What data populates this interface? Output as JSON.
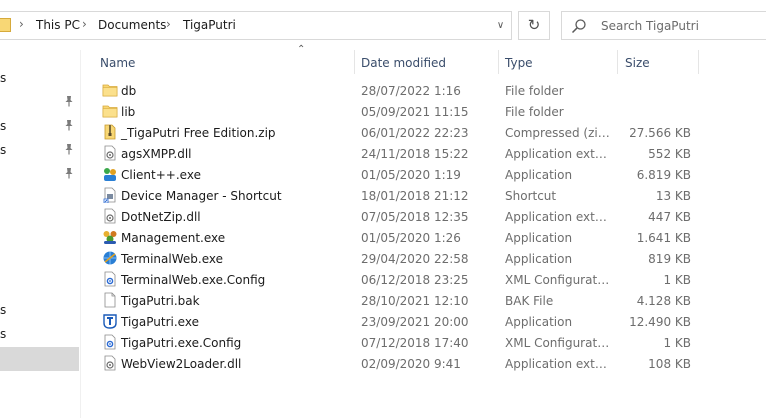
{
  "breadcrumb": {
    "items": [
      "This PC",
      "Documents",
      "TigaPutri"
    ],
    "separator": ">"
  },
  "search": {
    "placeholder": "Search TigaPutri"
  },
  "nav": {
    "fragments": [
      "s",
      "s",
      "s",
      "s",
      "s"
    ]
  },
  "columns": {
    "name": "Name",
    "date": "Date modified",
    "type": "Type",
    "size": "Size"
  },
  "files": [
    {
      "name": "db",
      "date": "28/07/2022 1:16",
      "type": "File folder",
      "size": "",
      "icon": "folder-icon"
    },
    {
      "name": "lib",
      "date": "05/09/2021 11:15",
      "type": "File folder",
      "size": "",
      "icon": "folder-icon"
    },
    {
      "name": "_TigaPutri Free Edition.zip",
      "date": "06/01/2022 22:23",
      "type": "Compressed (zipp...",
      "size": "27.566 KB",
      "icon": "zip-file-icon"
    },
    {
      "name": "agsXMPP.dll",
      "date": "24/11/2018 15:22",
      "type": "Application exten...",
      "size": "552 KB",
      "icon": "dll-file-icon"
    },
    {
      "name": "Client++.exe",
      "date": "01/05/2020 1:19",
      "type": "Application",
      "size": "6.819 KB",
      "icon": "client-app-icon"
    },
    {
      "name": "Device Manager - Shortcut",
      "date": "18/01/2018 21:12",
      "type": "Shortcut",
      "size": "13 KB",
      "icon": "device-manager-icon"
    },
    {
      "name": "DotNetZip.dll",
      "date": "07/05/2018 12:35",
      "type": "Application exten...",
      "size": "447 KB",
      "icon": "dll-file-icon"
    },
    {
      "name": "Management.exe",
      "date": "01/05/2020 1:26",
      "type": "Application",
      "size": "1.641 KB",
      "icon": "management-app-icon"
    },
    {
      "name": "TerminalWeb.exe",
      "date": "29/04/2020 22:58",
      "type": "Application",
      "size": "819 KB",
      "icon": "terminal-web-app-icon"
    },
    {
      "name": "TerminalWeb.exe.Config",
      "date": "06/12/2018 23:25",
      "type": "XML Configuratio...",
      "size": "1 KB",
      "icon": "config-file-icon"
    },
    {
      "name": "TigaPutri.bak",
      "date": "28/10/2021 12:10",
      "type": "BAK File",
      "size": "4.128 KB",
      "icon": "blank-file-icon"
    },
    {
      "name": "TigaPutri.exe",
      "date": "23/09/2021 20:00",
      "type": "Application",
      "size": "12.490 KB",
      "icon": "tigaputri-app-icon"
    },
    {
      "name": "TigaPutri.exe.Config",
      "date": "07/12/2018 17:40",
      "type": "XML Configuratio...",
      "size": "1 KB",
      "icon": "config-file-icon"
    },
    {
      "name": "WebView2Loader.dll",
      "date": "02/09/2020 9:41",
      "type": "Application exten...",
      "size": "108 KB",
      "icon": "dll-file-icon"
    }
  ]
}
